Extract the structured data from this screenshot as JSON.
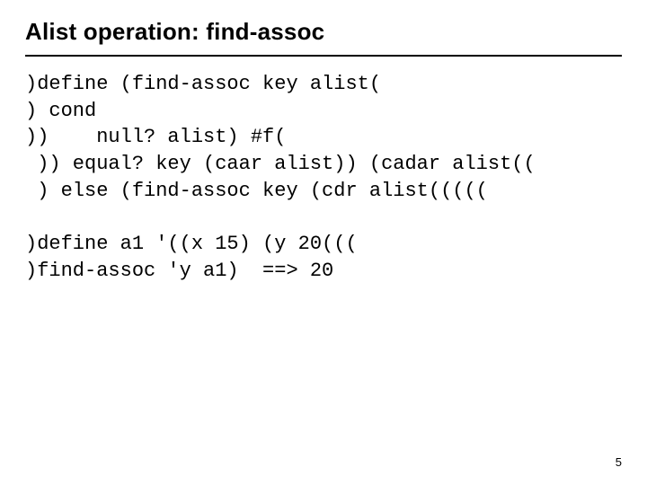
{
  "title": "Alist operation: find-assoc",
  "code": {
    "l1": ")define (find-assoc key alist(",
    "l2": ") cond",
    "l3": "))    null? alist) #f(",
    "l4": " )) equal? key (caar alist)) (cadar alist((",
    "l5": " ) else (find-assoc key (cdr alist(((((",
    "l6": ")define a1 '((x 15) (y 20(((",
    "l7": ")find-assoc 'y a1)  ==> 20"
  },
  "page_number": "5"
}
